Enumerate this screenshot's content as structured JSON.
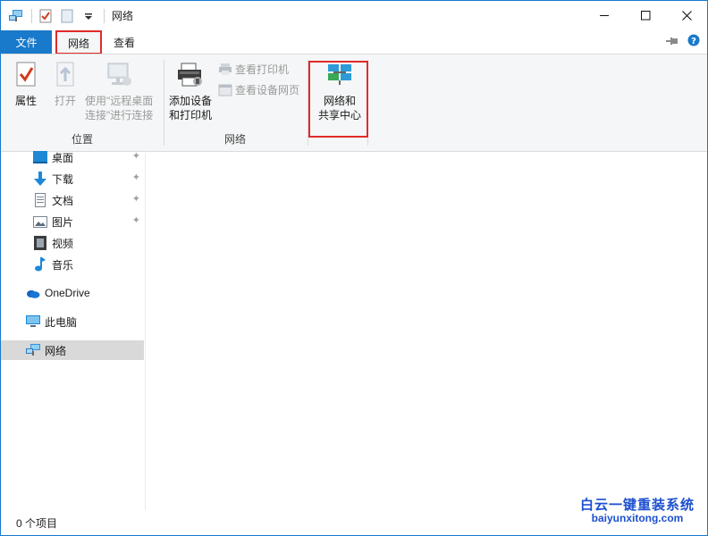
{
  "window": {
    "title": "网络"
  },
  "tabs": {
    "file": "文件",
    "network": "网络",
    "view": "查看"
  },
  "ribbon": {
    "location_group": {
      "label": "位置",
      "properties": "属性",
      "open": "打开",
      "remote_desktop_line1": "使用\"远程桌面",
      "remote_desktop_line2": "连接\"进行连接"
    },
    "network_group": {
      "label": "网络",
      "add_device_line1": "添加设备",
      "add_device_line2": "和打印机",
      "view_printers": "查看打印机",
      "view_device_webpage": "查看设备网页"
    },
    "sharing_center": {
      "line1": "网络和",
      "line2": "共享中心"
    }
  },
  "nav": {
    "items": [
      {
        "label": "桌面",
        "icon": "desktop-icon",
        "pinned": true
      },
      {
        "label": "下载",
        "icon": "download-icon",
        "pinned": true
      },
      {
        "label": "文档",
        "icon": "document-icon",
        "pinned": true
      },
      {
        "label": "图片",
        "icon": "pictures-icon",
        "pinned": true
      },
      {
        "label": "视频",
        "icon": "videos-icon",
        "pinned": false
      },
      {
        "label": "音乐",
        "icon": "music-icon",
        "pinned": false
      },
      {
        "label": "OneDrive",
        "icon": "onedrive-icon",
        "pinned": false
      },
      {
        "label": "此电脑",
        "icon": "this-pc-icon",
        "pinned": false
      },
      {
        "label": "网络",
        "icon": "network-icon",
        "pinned": false,
        "selected": true
      }
    ]
  },
  "status": {
    "item_count": "0 个项目"
  },
  "watermark": {
    "cn": "白云一键重装系统",
    "en": "baiyunxitong.com"
  },
  "colors": {
    "accent": "#1979ca",
    "highlight": "#e02b2b",
    "selected": "#d9d9d9"
  }
}
